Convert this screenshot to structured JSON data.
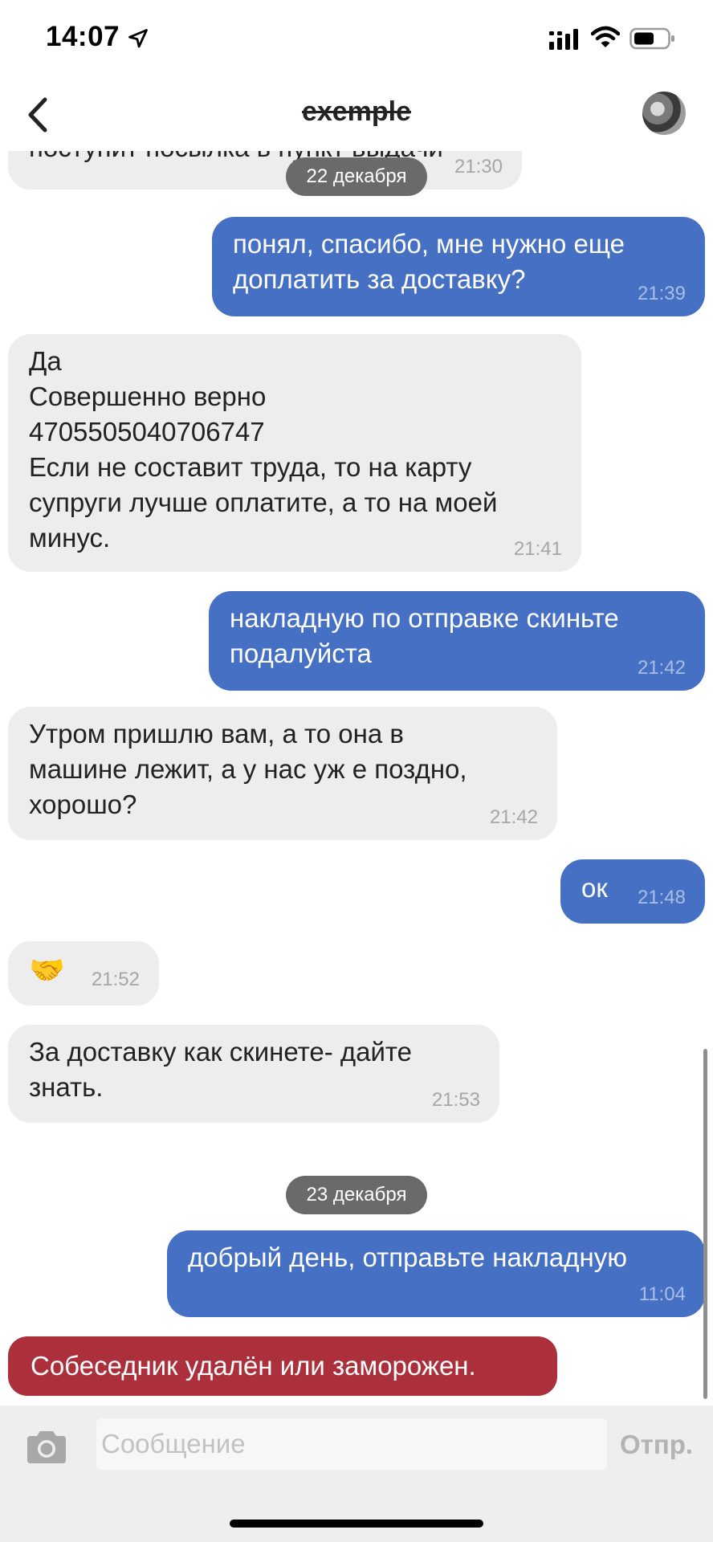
{
  "status_bar": {
    "time": "14:07",
    "location_icon": "location-arrow-icon",
    "signal_icon": "cellular-signal-icon",
    "wifi_icon": "wifi-icon",
    "battery_icon": "battery-icon"
  },
  "nav": {
    "back_icon": "chevron-left-icon",
    "title": "exemple",
    "avatar_icon": "contact-avatar"
  },
  "chat": {
    "top_cut_message": {
      "text": "поступит посылка в пункт выдачи",
      "time": "21:30"
    },
    "date_1": "22 декабря",
    "messages": [
      {
        "side": "out",
        "text": "понял, спасибо, мне нужно еще\nдоплатить за доставку?",
        "time": "21:39"
      },
      {
        "side": "in",
        "text": "Да\nСовершенно верно\n4705505040706747\nЕсли не составит труда, то на карту\nсупруги лучше оплатите, а то на моей\nминус.",
        "time": "21:41"
      },
      {
        "side": "out",
        "text": "накладную по отправке скиньте\nподалуйста",
        "time": "21:42"
      },
      {
        "side": "in",
        "text": "Утром пришлю вам, а то она в\nмашине лежит, а у нас уж е поздно,\nхорошо?",
        "time": "21:42"
      },
      {
        "side": "out",
        "text": "ок",
        "time": "21:48"
      },
      {
        "side": "in",
        "text": "🤝",
        "time": "21:52"
      },
      {
        "side": "in",
        "text": "За доставку как скинете- дайте\nзнать.",
        "time": "21:53"
      }
    ],
    "date_2": "23 декабря",
    "last_message": {
      "side": "out",
      "text": "добрый день, отправьте накладную",
      "time": "11:04"
    },
    "error_banner": "Собеседник удалён или заморожен."
  },
  "input_bar": {
    "camera_icon": "camera-icon",
    "placeholder": "Сообщение",
    "send_label": "Отпр."
  },
  "colors": {
    "outgoing": "#4570c4",
    "incoming": "#ededed",
    "error": "#ac2f3c",
    "date_pill": "#6a6a6a"
  }
}
